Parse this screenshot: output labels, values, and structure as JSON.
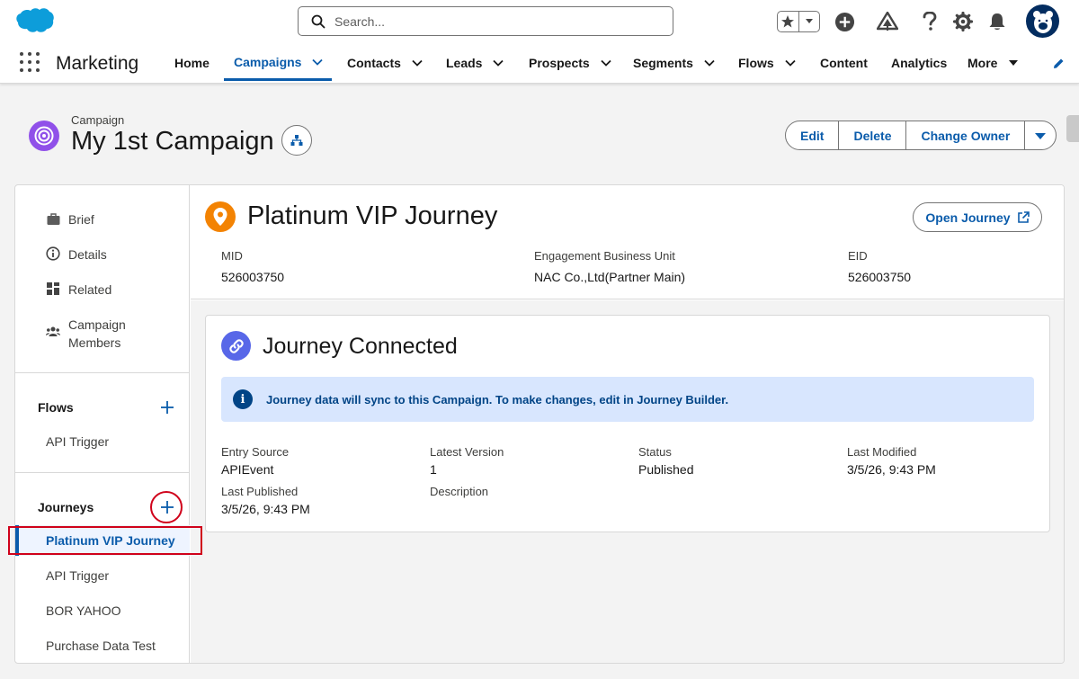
{
  "header": {
    "search_placeholder": "Search...",
    "icons": [
      "salesforce-cloud-icon",
      "search-icon",
      "star-icon",
      "chevron-down-icon",
      "plus-icon",
      "trailhead-icon",
      "help-icon",
      "gear-icon",
      "bell-icon",
      "avatar"
    ]
  },
  "nav": {
    "app_name": "Marketing",
    "items": [
      {
        "label": "Home"
      },
      {
        "label": "Campaigns"
      },
      {
        "label": "Contacts"
      },
      {
        "label": "Leads"
      },
      {
        "label": "Prospects"
      },
      {
        "label": "Segments"
      },
      {
        "label": "Flows"
      },
      {
        "label": "Content"
      },
      {
        "label": "Analytics"
      },
      {
        "label": "More"
      }
    ]
  },
  "record": {
    "object_label": "Campaign",
    "title": "My 1st Campaign",
    "actions": {
      "edit": "Edit",
      "delete": "Delete",
      "change_owner": "Change Owner"
    }
  },
  "sidebar": {
    "items": [
      {
        "label": "Brief"
      },
      {
        "label": "Details"
      },
      {
        "label": "Related"
      },
      {
        "label": "Campaign\nMembers"
      }
    ],
    "flows": {
      "title": "Flows",
      "items": [
        "API Trigger"
      ]
    },
    "journeys": {
      "title": "Journeys",
      "items": [
        "Platinum VIP Journey",
        "API Trigger",
        "BOR YAHOO",
        "Purchase Data Test"
      ]
    }
  },
  "journey": {
    "title": "Platinum VIP Journey",
    "open_button": "Open Journey",
    "meta": [
      {
        "label": "MID",
        "value": "526003750"
      },
      {
        "label": "Engagement Business Unit",
        "value": "NAC Co.,Ltd(Partner Main)"
      },
      {
        "label": "EID",
        "value": "526003750"
      }
    ]
  },
  "connection": {
    "title": "Journey Connected",
    "info": "Journey data will sync to this Campaign. To make changes, edit in Journey Builder.",
    "fields": [
      {
        "label": "Entry Source",
        "value": "APIEvent"
      },
      {
        "label": "Latest Version",
        "value": "1"
      },
      {
        "label": "Status",
        "value": "Published"
      },
      {
        "label": "Last Modified",
        "value": "3/5/26, 9:43 PM"
      },
      {
        "label": "Last Published",
        "value": "3/5/26, 9:43 PM"
      },
      {
        "label": "Description",
        "value": ""
      }
    ]
  },
  "colors": {
    "brand_blue": "#0b5cab",
    "campaign_purple": "#9050e9",
    "journey_orange": "#f38303",
    "link_indigo": "#5867e8",
    "highlight_red": "#d0021b"
  }
}
